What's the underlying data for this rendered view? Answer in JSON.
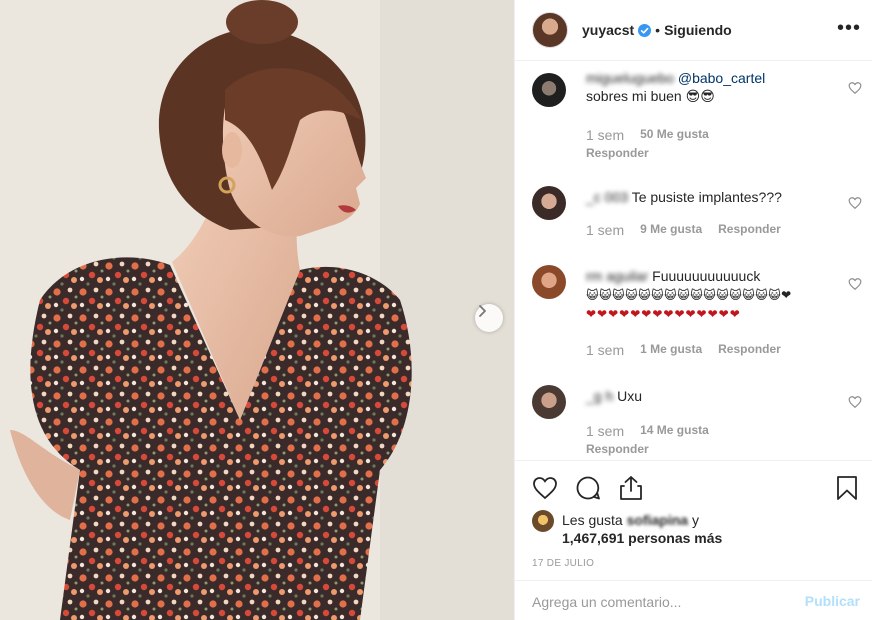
{
  "header": {
    "username": "yuyacst",
    "dot": "•",
    "follow_label": "Siguiendo",
    "more_label": "•••"
  },
  "comments": [
    {
      "user": "migueluguebo",
      "mention": "@babo_cartel",
      "text": "sobres mi buen 😎😎",
      "time": "1 sem",
      "likes": "50 Me gusta",
      "reply": "Responder"
    },
    {
      "user": "_c 003",
      "text": "Te pusiste implantes???",
      "time": "1 sem",
      "likes": "9 Me gusta",
      "reply": "Responder"
    },
    {
      "user": "rm aguilar",
      "text": "Fuuuuuuuuuuuck",
      "emoji_line": "😺😺😺😺😺😺😺😺😺😺😺😺😺😺😺❤",
      "hearts_line": "❤❤❤❤❤❤❤❤❤❤❤❤❤❤",
      "time": "1 sem",
      "likes": "1 Me gusta",
      "reply": "Responder"
    },
    {
      "user": "_g h",
      "text": "Uxu",
      "time": "1 sem",
      "likes": "14 Me gusta",
      "reply": "Responder"
    }
  ],
  "likes": {
    "prefix": "Les gusta",
    "user": "sofiapina",
    "suffix": "y",
    "count_text": "1,467,691 personas más"
  },
  "date": "17 DE JULIO",
  "add_comment": {
    "placeholder": "Agrega un comentario...",
    "publish_label": "Publicar"
  },
  "colors": {
    "accent": "#3897f0",
    "publish_disabled": "#b2dffc",
    "mention": "#003569",
    "muted": "#999999",
    "heart_red": "#c0161c"
  },
  "icons": [
    "next-arrow-icon",
    "verified-badge-icon",
    "more-options-icon",
    "heart-icon",
    "comment-icon",
    "share-icon",
    "bookmark-icon"
  ]
}
